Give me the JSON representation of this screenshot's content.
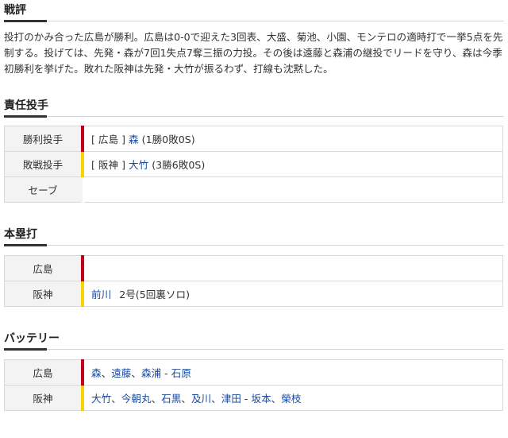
{
  "review": {
    "title": "戦評",
    "text": "投打のかみ合った広島が勝利。広島は0-0で迎えた3回表、大盛、菊池、小園、モンテロの適時打で一挙5点を先制する。投げては、先発・森が7回1失点7奪三振の力投。その後は遠藤と森浦の継投でリードを守り、森は今季初勝利を挙げた。敗れた阪神は先発・大竹が振るわず、打線も沈黙した。"
  },
  "pitchers": {
    "title": "責任投手",
    "rows": [
      {
        "label": "勝利投手",
        "team": "[ 広島 ]",
        "name": "森",
        "record": "(1勝0敗0S)",
        "color": "#c0001b"
      },
      {
        "label": "敗戦投手",
        "team": "[ 阪神 ]",
        "name": "大竹",
        "record": "(3勝6敗0S)",
        "color": "#f5d400"
      },
      {
        "label": "セーブ",
        "team": "",
        "name": "",
        "record": ""
      }
    ]
  },
  "homeruns": {
    "title": "本塁打",
    "rows": [
      {
        "label": "広島",
        "name": "",
        "detail": "",
        "color": "#c0001b"
      },
      {
        "label": "阪神",
        "name": "前川",
        "detail": "2号(5回裏ソロ)",
        "color": "#f5d400"
      }
    ]
  },
  "battery": {
    "title": "バッテリー",
    "hiroshima": {
      "label": "広島",
      "pitchers": [
        "森",
        "遠藤",
        "森浦"
      ],
      "catchers": [
        "石原"
      ]
    },
    "hanshin": {
      "label": "阪神",
      "pitchers": [
        "大竹",
        "今朝丸",
        "石黒",
        "及川",
        "津田"
      ],
      "catchers": [
        "坂本",
        "榮枝"
      ]
    },
    "sep": "、",
    "dash": "-"
  }
}
